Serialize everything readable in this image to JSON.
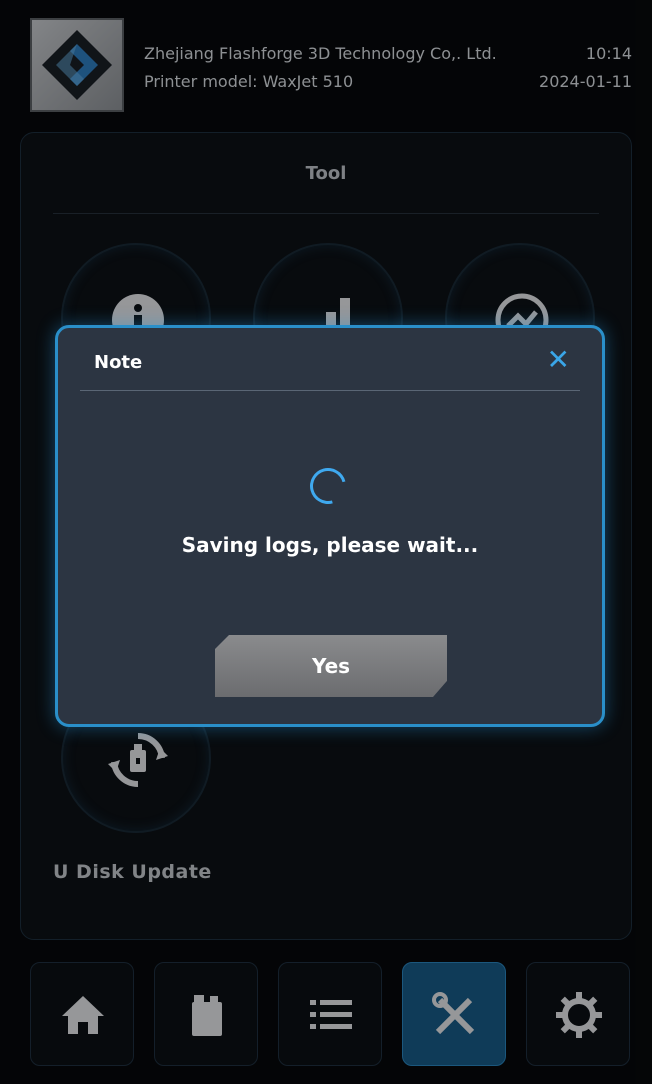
{
  "header": {
    "company": "Zhejiang Flashforge 3D Technology Co,. Ltd.",
    "printer_model": "Printer model: WaxJet 510",
    "time": "10:14",
    "date": "2024-01-11"
  },
  "panel": {
    "title": "Tool",
    "tools": [
      {
        "icon": "info-icon"
      },
      {
        "icon": "signal-bars-icon"
      },
      {
        "icon": "chart-icon"
      },
      {
        "icon": "usb-refresh-icon",
        "label": "U Disk Update"
      }
    ]
  },
  "dialog": {
    "title": "Note",
    "close_icon": "close-icon",
    "message": "Saving logs, please wait...",
    "confirm_label": "Yes"
  },
  "nav": [
    {
      "icon": "home-icon",
      "active": false
    },
    {
      "icon": "material-bottle-icon",
      "active": false
    },
    {
      "icon": "list-icon",
      "active": false
    },
    {
      "icon": "tools-icon",
      "active": true
    },
    {
      "icon": "gear-icon",
      "active": false
    }
  ],
  "colors": {
    "accent": "#2a8fc9",
    "background": "#07090b",
    "dialog_bg": "#2c3542",
    "active_nav": "#175b87"
  }
}
